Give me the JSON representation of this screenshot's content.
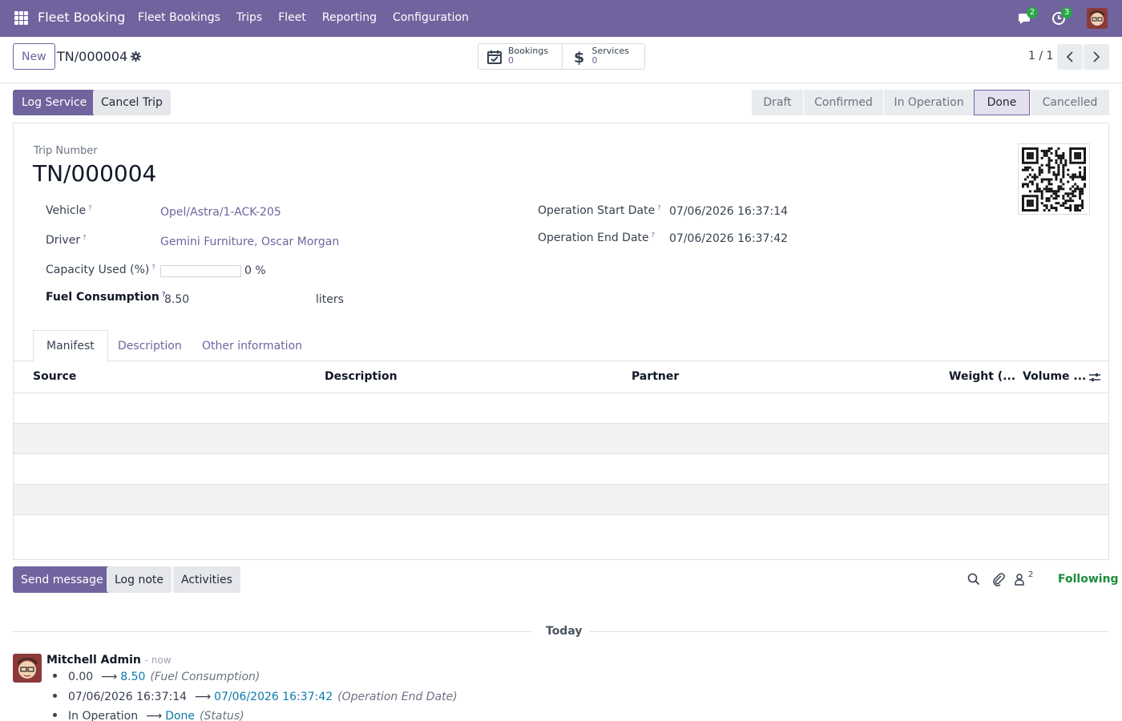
{
  "navbar": {
    "app_title": "Fleet Booking",
    "menu": [
      "Fleet Bookings",
      "Trips",
      "Fleet",
      "Reporting",
      "Configuration"
    ],
    "messages_count": "2",
    "activities_count": "3",
    "colors": {
      "navbar_bg": "#71639e",
      "badge": "#28a745"
    }
  },
  "control": {
    "new_label": "New",
    "record_name": "TN/000004",
    "smart_buttons": [
      {
        "label": "Bookings",
        "value": "0",
        "icon": "calendar-check-icon"
      },
      {
        "label": "Services",
        "value": "0",
        "icon": "dollar-icon"
      }
    ],
    "pager": "1 / 1"
  },
  "actions": {
    "log_service": "Log Service",
    "cancel_trip": "Cancel Trip"
  },
  "statusbar": {
    "stages": [
      "Draft",
      "Confirmed",
      "In Operation",
      "Done",
      "Cancelled"
    ],
    "active": "Done"
  },
  "form": {
    "trip_number_label": "Trip Number",
    "trip_number": "TN/000004",
    "help_mark": "?",
    "vehicle_label": "Vehicle",
    "vehicle": "Opel/Astra/1-ACK-205",
    "driver_label": "Driver",
    "driver": "Gemini Furniture, Oscar Morgan",
    "capacity_label": "Capacity Used (%)",
    "capacity_value": "0 %",
    "capacity_fraction": 0,
    "fuel_label": "Fuel Consumption",
    "fuel_value": "8.50",
    "fuel_unit": "liters",
    "start_label": "Operation Start Date",
    "start_value": "07/06/2026 16:37:14",
    "end_label": "Operation End Date",
    "end_value": "07/06/2026 16:37:42"
  },
  "tabs": [
    "Manifest",
    "Description",
    "Other information"
  ],
  "table": {
    "columns": [
      "Source",
      "Description",
      "Partner",
      "Weight (...",
      "Volume ..."
    ]
  },
  "chatter": {
    "send_message": "Send message",
    "log_note": "Log note",
    "activities": "Activities",
    "followers_count": "2",
    "following": "Following",
    "today": "Today",
    "author": "Mitchell Admin",
    "when": "- now",
    "changes": [
      {
        "old": "0.00",
        "new": "8.50",
        "field": "(Fuel Consumption)"
      },
      {
        "old": "07/06/2026 16:37:14",
        "new": "07/06/2026 16:37:42",
        "field": "(Operation End Date)"
      },
      {
        "old": "In Operation",
        "new": "Done",
        "field": "(Status)"
      }
    ]
  }
}
